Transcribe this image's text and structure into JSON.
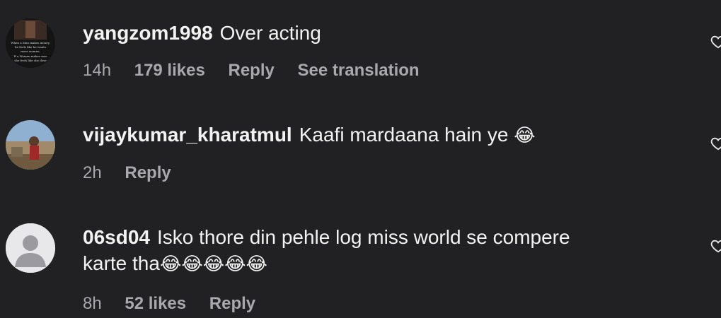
{
  "comments": [
    {
      "username": "yangzom1998",
      "text": "Over acting",
      "emojis": "",
      "text_line2": "",
      "time": "14h",
      "likes": "179 likes",
      "reply": "Reply",
      "translate": "See translation",
      "avatar_text": [
        "When a Man makes money,",
        "he feels like he wants",
        "more women.",
        "If a Woman makes mor",
        "she feels like she dese"
      ]
    },
    {
      "username": "vijaykumar_kharatmul",
      "text": "Kaafi mardaana hain ye",
      "emojis": "😂",
      "text_line2": "",
      "time": "2h",
      "likes": "",
      "reply": "Reply",
      "translate": ""
    },
    {
      "username": "06sd04",
      "text": "Isko thore din pehle log miss world se compere",
      "emojis": "",
      "text_line2": "karte tha",
      "text_line2_emojis": "😂😂😂😂😂",
      "time": "8h",
      "likes": "52 likes",
      "reply": "Reply",
      "translate": ""
    }
  ]
}
